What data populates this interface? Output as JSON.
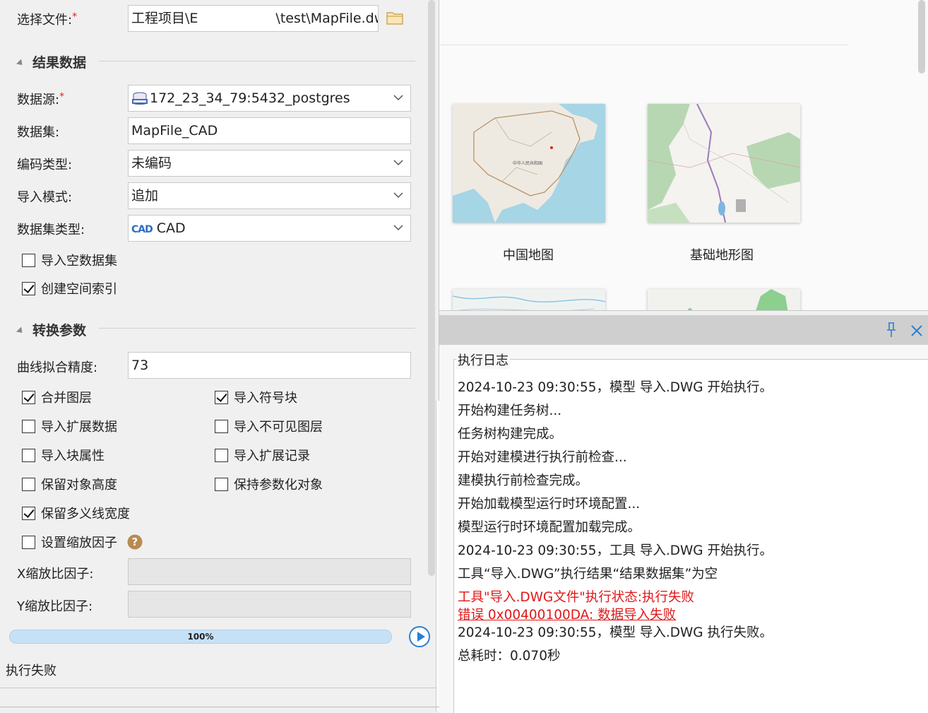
{
  "form": {
    "select_file_label": "选择文件:",
    "required_mark": "*",
    "file_path_value": "工程项目\\E:...\\test\\MapFile.dwg",
    "file_path_start": "工程项目\\E",
    "file_path_end": "\\test\\MapFile.dwg",
    "result_section_title": "结果数据",
    "datasource_label": "数据源:",
    "datasource_value": "172_23_34_79:5432_postgres",
    "dataset_label": "数据集:",
    "dataset_value": "MapFile_CAD",
    "encoding_label": "编码类型:",
    "encoding_value": "未编码",
    "import_mode_label": "导入模式:",
    "import_mode_value": "追加",
    "dataset_type_label": "数据集类型:",
    "dataset_type_badge": "CAD",
    "dataset_type_value": "CAD",
    "import_empty_label": "导入空数据集",
    "create_index_label": "创建空间索引",
    "convert_section_title": "转换参数",
    "curve_precision_label": "曲线拟合精度:",
    "curve_precision_value": "73",
    "merge_layers_label": "合并图层",
    "import_symbol_label": "导入符号块",
    "import_ext_data_label": "导入扩展数据",
    "import_invisible_label": "导入不可见图层",
    "import_block_attr_label": "导入块属性",
    "import_ext_record_label": "导入扩展记录",
    "keep_height_label": "保留对象高度",
    "keep_param_label": "保持参数化对象",
    "keep_polyline_width_label": "保留多义线宽度",
    "set_scale_label": "设置缩放因子",
    "x_scale_label": "X缩放比因子:",
    "y_scale_label": "Y缩放比因子:",
    "progress_value": 1.0,
    "progress_text": "100%",
    "status_text": "执行失败"
  },
  "gallery": {
    "china_map_label": "中国地图",
    "china_map_inner_text": "中华人民共和国",
    "basic_terrain_label": "基础地形图"
  },
  "log": {
    "title": "执行日志",
    "lines": [
      "2024-10-23 09:30:55，模型 导入.DWG 开始执行。",
      "开始构建任务树...",
      "任务树构建完成。",
      "开始对建模进行执行前检查...",
      "建模执行前检查完成。",
      "开始加载模型运行时环境配置...",
      "模型运行时环境配置加载完成。",
      "2024-10-23 09:30:55，工具 导入.DWG 开始执行。",
      "工具“导入.DWG”执行结果“结果数据集”为空",
      "工具\"导入.DWG文件\"执行状态:执行失败",
      "错误 0x00400100DA:  数据导入失败",
      "2024-10-23 09:30:55，模型 导入.DWG 执行失败。",
      "总耗时：0.070秒"
    ]
  },
  "colors": {
    "error": "#e01818",
    "accent": "#2a7fd4",
    "progress": "#c6e1f6",
    "teal": "#1ab39a"
  }
}
